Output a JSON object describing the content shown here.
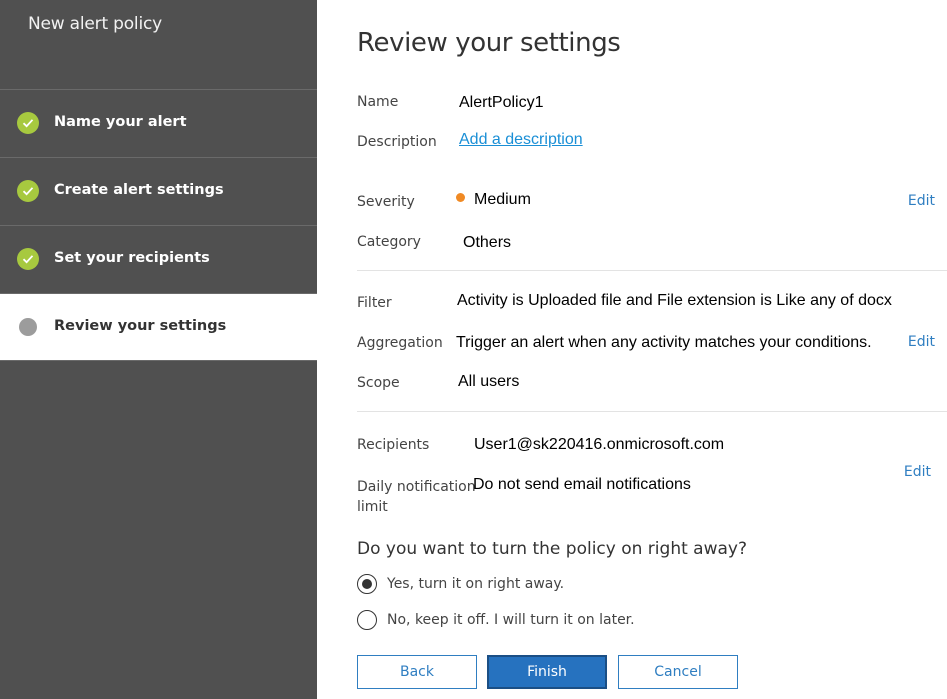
{
  "sidebar": {
    "title": "New alert policy",
    "steps": [
      {
        "label": "Name your alert",
        "status": "complete"
      },
      {
        "label": "Create alert settings",
        "status": "complete"
      },
      {
        "label": "Set your recipients",
        "status": "complete"
      },
      {
        "label": "Review your settings",
        "status": "current"
      }
    ]
  },
  "main": {
    "title": "Review your settings",
    "name_label": "Name",
    "name_value": "AlertPolicy1",
    "description_label": "Description",
    "description_link": "Add a description",
    "severity_label": "Severity",
    "severity_value": "Medium",
    "severity_color": "#f08a24",
    "category_label": "Category",
    "category_value": "Others",
    "filter_label": "Filter",
    "filter_value": "Activity is Uploaded file and File extension is Like any of docx",
    "aggregation_label": "Aggregation",
    "aggregation_value": "Trigger an alert when any activity matches your conditions.",
    "scope_label": "Scope",
    "scope_value": "All users",
    "recipients_label": "Recipients",
    "recipients_value": "User1@sk220416.onmicrosoft.com",
    "daily_limit_label_line1": "Daily notification",
    "daily_limit_label_line2": "limit",
    "daily_limit_value": "Do not send email notifications",
    "edit_label": "Edit",
    "question": "Do you want to turn the policy on right away?",
    "options": [
      {
        "label": "Yes, turn it on right away.",
        "selected": true
      },
      {
        "label": "No, keep it off. I will turn it on later.",
        "selected": false
      }
    ],
    "buttons": {
      "back": "Back",
      "finish": "Finish",
      "cancel": "Cancel"
    }
  },
  "colors": {
    "accent": "#2672bf",
    "check_green": "#a7c93f",
    "sidebar_bg": "#505050"
  }
}
